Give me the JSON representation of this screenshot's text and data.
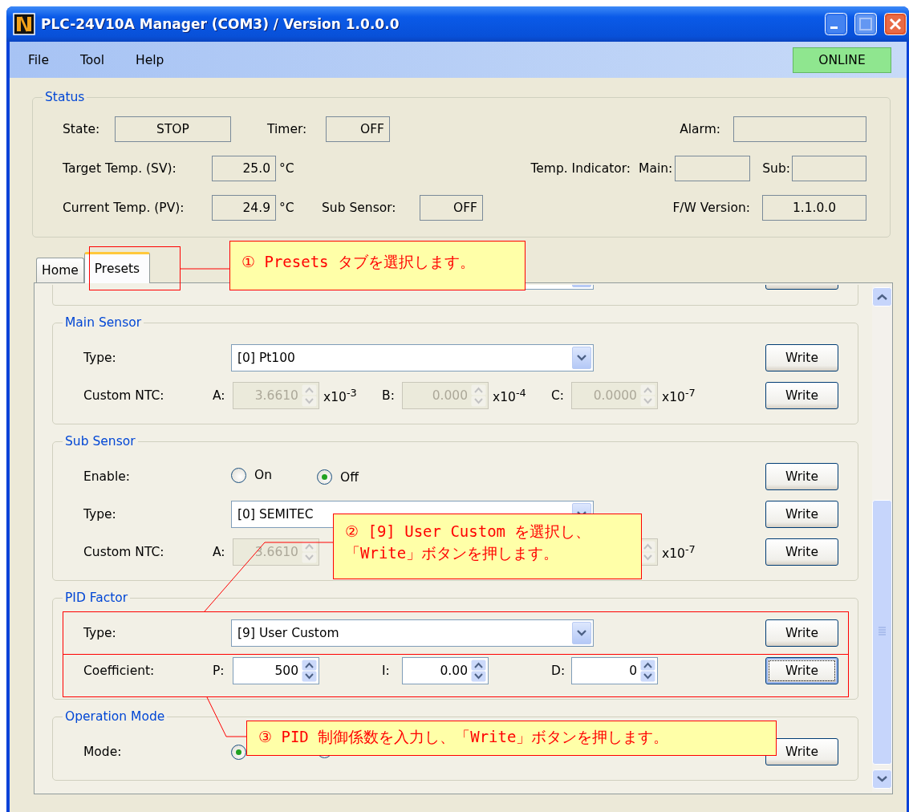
{
  "window": {
    "title": "PLC-24V10A Manager (COM3) / Version 1.0.0.0"
  },
  "menu": [
    "File",
    "Tool",
    "Help"
  ],
  "connection": {
    "label": "ONLINE",
    "online": true
  },
  "status": {
    "title": "Status",
    "state": {
      "label": "State:",
      "value": "STOP"
    },
    "timer": {
      "label": "Timer:",
      "value": "OFF"
    },
    "alarm": {
      "label": "Alarm:"
    },
    "target_temp": {
      "label": "Target Temp. (SV):",
      "value": "25.0",
      "unit": "°C"
    },
    "temp_indicator": {
      "label": "Temp. Indicator:",
      "main_label": "Main:",
      "sub_label": "Sub:"
    },
    "current_temp": {
      "label": "Current Temp. (PV):",
      "value": "24.9",
      "unit": "°C"
    },
    "sub_sensor": {
      "label": "Sub Sensor:",
      "value": "OFF"
    },
    "fw_version": {
      "label": "F/W Version:",
      "value": "1.1.0.0"
    }
  },
  "tabs": [
    {
      "label": "Home",
      "selected": false
    },
    {
      "label": "Presets",
      "selected": true
    }
  ],
  "groups": [
    {
      "title": "Main Sensor",
      "rows": [
        {
          "kind": "combo",
          "label": "Type:",
          "value": "[0] Pt100",
          "button": {
            "label": "Write",
            "focused": false
          }
        },
        {
          "kind": "coefficients",
          "label": "Custom NTC:",
          "button": {
            "label": "Write",
            "focused": false
          },
          "params": [
            {
              "label": "A:",
              "value": "3.6610",
              "unit": "x10$^{-3}$",
              "disabled": true
            },
            {
              "label": "B:",
              "value": "0.000",
              "unit": "x10$^{-4}$",
              "disabled": true
            },
            {
              "label": "C:",
              "value": "0.0000",
              "unit": "x10$^{-7}$",
              "disabled": true
            }
          ]
        }
      ]
    },
    {
      "title": "Sub Sensor",
      "rows": [
        {
          "kind": "radio",
          "label": "Enable:",
          "button": {
            "label": "Write",
            "focused": false
          },
          "options": [
            {
              "label": "On",
              "selected": false
            },
            {
              "label": "Off",
              "selected": true
            }
          ]
        },
        {
          "kind": "combo",
          "label": "Type:",
          "value": "[0] SEMITEC",
          "button": {
            "label": "Write",
            "focused": false
          }
        },
        {
          "kind": "coefficients",
          "label": "Custom NTC:",
          "button": {
            "label": "Write",
            "focused": false
          },
          "params": [
            {
              "label": "A:",
              "value": "3.6610",
              "disabled": true
            },
            {
              "unit": "x10$^{-7}$",
              "disabled": true
            }
          ]
        }
      ]
    },
    {
      "title": "PID Factor",
      "rows": [
        {
          "kind": "combo",
          "label": "Type:",
          "value": "[9] User Custom",
          "button": {
            "label": "Write",
            "focused": false
          }
        },
        {
          "kind": "coefficients",
          "label": "Coefficient:",
          "button": {
            "label": "Write",
            "focused": true
          },
          "params": [
            {
              "label": "P:",
              "value": "500",
              "disabled": false
            },
            {
              "label": "I:",
              "value": "0.00",
              "disabled": false
            },
            {
              "label": "D:",
              "value": "0",
              "disabled": false
            }
          ]
        }
      ]
    },
    {
      "title": "Operation Mode",
      "rows": [
        {
          "kind": "radio",
          "label": "Mode:",
          "button": {
            "label": "Write",
            "focused": false
          },
          "options": [
            {
              "selected": true
            },
            {
              "selected": false
            }
          ]
        }
      ]
    }
  ],
  "callouts": [
    {
      "lines": [
        "① Presets タブを選択します。"
      ]
    },
    {
      "lines": [
        "② [9] User Custom を選択し、",
        "「Write」ボタンを押します。"
      ]
    },
    {
      "lines": [
        "③ PID 制御係数を入力し、「Write」ボタンを押します。"
      ]
    }
  ]
}
